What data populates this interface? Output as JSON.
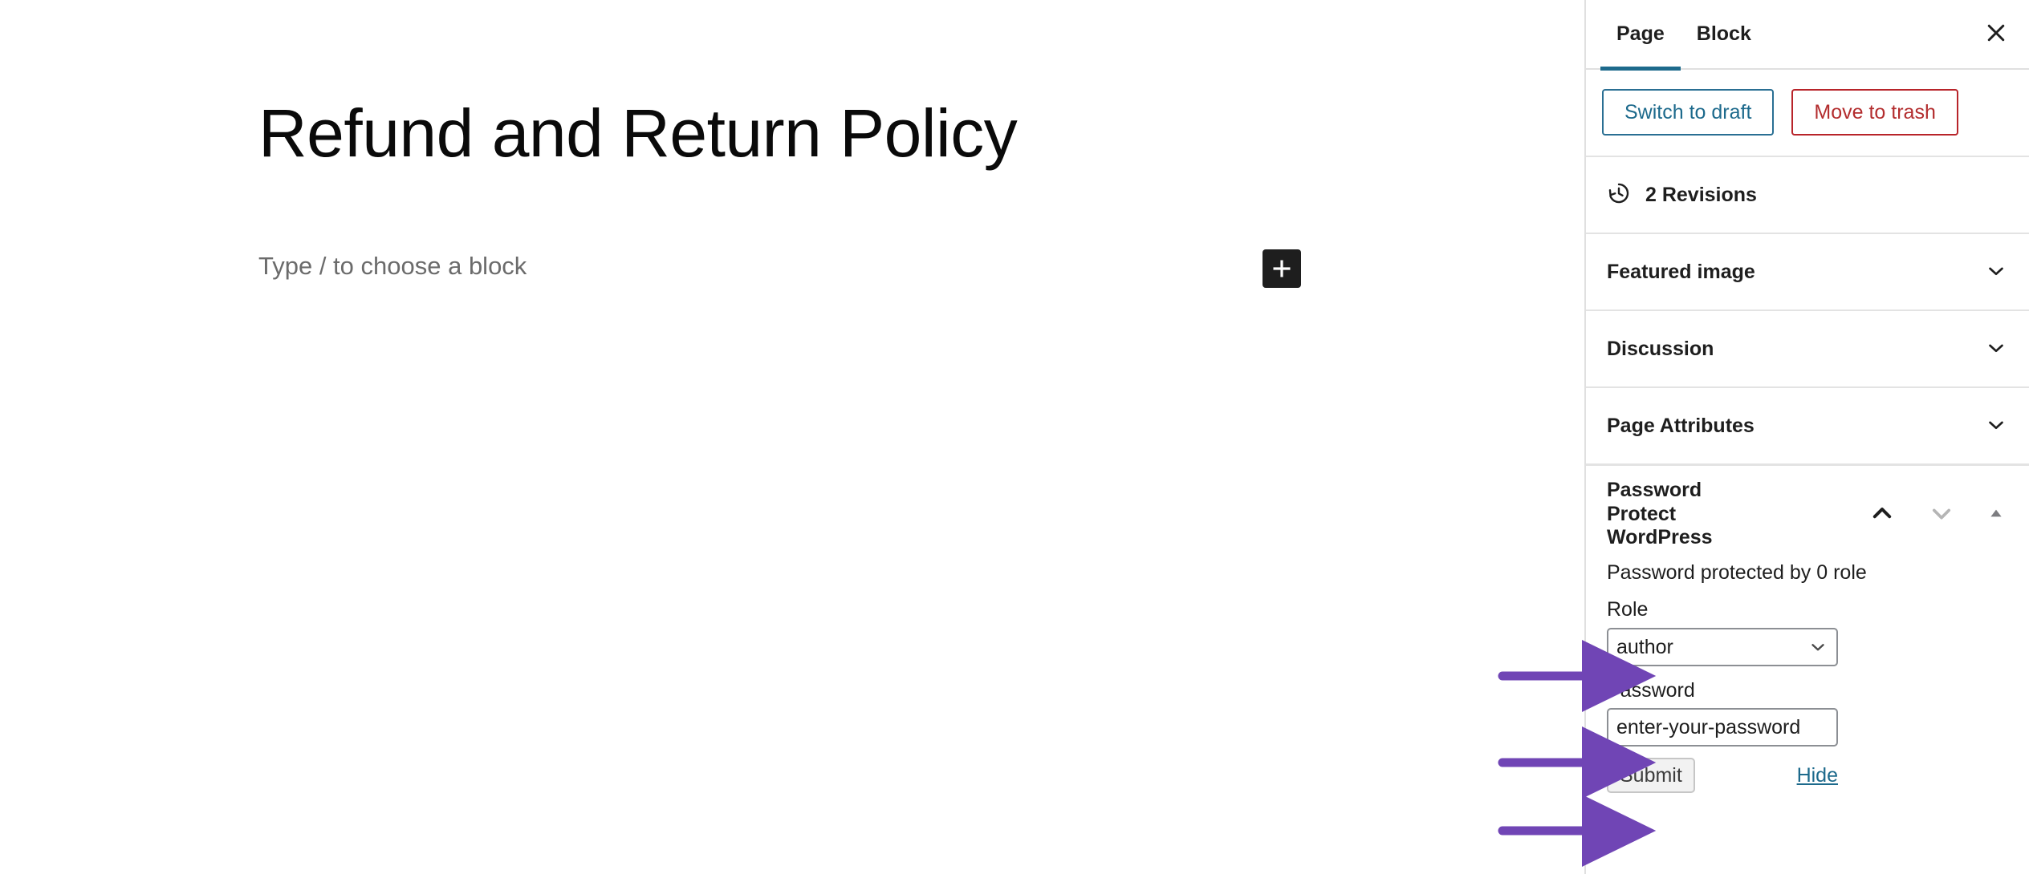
{
  "editor": {
    "post_title": "Refund and Return Policy",
    "block_placeholder": "Type / to choose a block",
    "add_block_icon": "plus-icon"
  },
  "sidebar": {
    "tabs": [
      {
        "label": "Page",
        "active": true
      },
      {
        "label": "Block",
        "active": false
      }
    ],
    "close_icon": "close-icon",
    "status_actions": {
      "switch_to_draft_label": "Switch to draft",
      "move_to_trash_label": "Move to trash",
      "draft_color": "#1d6a8c",
      "trash_color": "#b32d2e"
    },
    "revisions": {
      "icon": "clock-revisions-icon",
      "label": "2 Revisions"
    },
    "panels": [
      {
        "title": "Featured image",
        "icon": "chevron-down-icon",
        "expanded": false
      },
      {
        "title": "Discussion",
        "icon": "chevron-down-icon",
        "expanded": false
      },
      {
        "title": "Page Attributes",
        "icon": "chevron-down-icon",
        "expanded": false
      }
    ],
    "password_protect": {
      "title": "Password Protect WordPress",
      "header_icons": [
        {
          "name": "chevron-up-icon",
          "state": "active"
        },
        {
          "name": "chevron-down-icon",
          "state": "muted"
        },
        {
          "name": "triangle-up-icon",
          "state": "muted"
        }
      ],
      "status_text": "Password protected by 0 role",
      "role_label": "Role",
      "role_value": "author",
      "role_options": [
        "author"
      ],
      "role_chevron_icon": "chevron-down-icon",
      "password_label": "Password",
      "password_value": "enter-your-password",
      "submit_label": "Submit",
      "hide_label": "Hide"
    }
  },
  "annotations": {
    "arrow_color": "#7045b5",
    "arrows": [
      {
        "target": "role-select",
        "direction": "right"
      },
      {
        "target": "password-input",
        "direction": "right"
      },
      {
        "target": "submit-button",
        "direction": "right"
      }
    ]
  }
}
